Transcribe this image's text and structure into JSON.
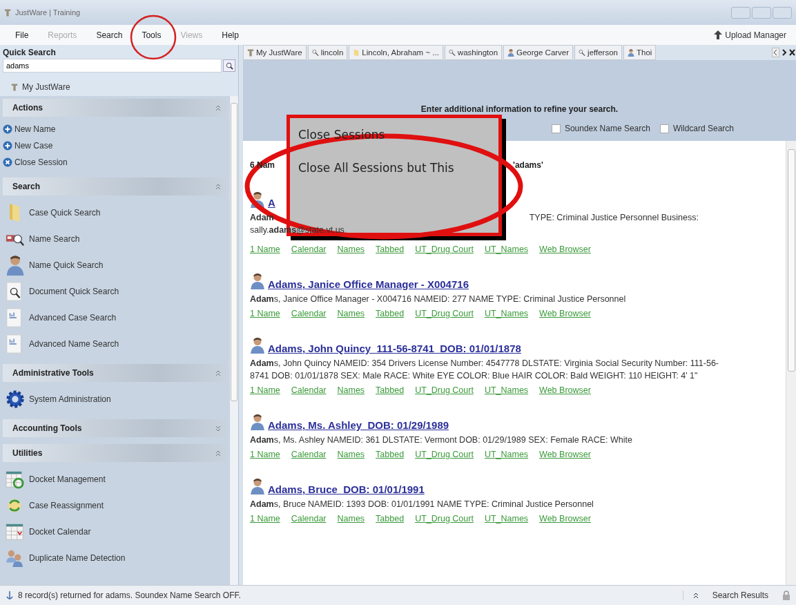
{
  "window": {
    "title": "JustWare | Training"
  },
  "menu": [
    {
      "label": "File",
      "disabled": false
    },
    {
      "label": "Reports",
      "disabled": true
    },
    {
      "label": "Search",
      "disabled": false
    },
    {
      "label": "Tools",
      "disabled": false
    },
    {
      "label": "Views",
      "disabled": true
    },
    {
      "label": "Help",
      "disabled": false
    }
  ],
  "upload_manager": "Upload Manager",
  "quick_search": {
    "label": "Quick Search",
    "value": "adams"
  },
  "home_link": "My JustWare",
  "sections": [
    {
      "title": "Actions",
      "expanded": true,
      "items": [
        {
          "label": "New Name",
          "kind": "add"
        },
        {
          "label": "New Case",
          "kind": "add"
        },
        {
          "label": "Close Session",
          "kind": "close"
        }
      ]
    },
    {
      "title": "Search",
      "expanded": true,
      "items": [
        {
          "label": "Case Quick Search",
          "kind": "folder"
        },
        {
          "label": "Name Search",
          "kind": "card"
        },
        {
          "label": "Name Quick Search",
          "kind": "person"
        },
        {
          "label": "Document Quick Search",
          "kind": "document"
        },
        {
          "label": "Advanced Case Search",
          "kind": "report"
        },
        {
          "label": "Advanced Name Search",
          "kind": "report"
        }
      ]
    },
    {
      "title": "Administrative Tools",
      "expanded": true,
      "items": [
        {
          "label": "System Administration",
          "kind": "gear"
        }
      ]
    },
    {
      "title": "Accounting Tools",
      "expanded": false
    },
    {
      "title": "Utilities",
      "expanded": true,
      "items": [
        {
          "label": "Docket Management",
          "kind": "docket"
        },
        {
          "label": "Case Reassignment",
          "kind": "reassign"
        },
        {
          "label": "Docket Calendar",
          "kind": "calendar"
        },
        {
          "label": "Duplicate Name Detection",
          "kind": "people"
        }
      ]
    }
  ],
  "tabs": [
    {
      "label": "My JustWare",
      "kind": "home"
    },
    {
      "label": "lincoln",
      "kind": "search"
    },
    {
      "label": "Lincoln, Abraham ~ ...",
      "kind": "folder"
    },
    {
      "label": "washington",
      "kind": "search"
    },
    {
      "label": "George Carver",
      "kind": "person"
    },
    {
      "label": "jefferson",
      "kind": "search"
    },
    {
      "label": "Thoi",
      "kind": "person"
    }
  ],
  "refine": {
    "prompt": "Enter additional information to refine your search.",
    "options": [
      {
        "label": "Soundex Name Search",
        "checked": false
      },
      {
        "label": "Wildcard Search",
        "checked": false
      }
    ]
  },
  "results_heading": [
    "6 Nam",
    "'adams'"
  ],
  "results": [
    {
      "title": "A",
      "description": [
        "**Adam**",
        "TYPE: Criminal Justice Personnel Business:"
      ],
      "description_more": "sally.**adams**@state.vt.us",
      "links": [
        "1 Name",
        "Calendar",
        "Names",
        "Tabbed",
        "UT_Drug Court",
        "UT_Names",
        "Web Browser"
      ]
    },
    {
      "title": "Adams, Janice Office Manager - X004716",
      "description": [
        "**Adam**s, Janice Office Manager - X004716 NAMEID: 277 NAME TYPE: Criminal Justice Personnel"
      ],
      "links": [
        "1 Name",
        "Calendar",
        "Names",
        "Tabbed",
        "UT_Drug Court",
        "UT_Names",
        "Web Browser"
      ]
    },
    {
      "title": "Adams, John Quincy  111-56-8741  DOB: 01/01/1878",
      "description": [
        "**Adam**s, John Quincy NAMEID: 354 Drivers License Number: 4547778 DLSTATE: Virginia Social Security Number: 111-56-8741 DOB: 01/01/1878 SEX: Male RACE: White EYE COLOR: Blue HAIR COLOR: Bald WEIGHT: 110 HEIGHT: 4' 1\""
      ],
      "links": [
        "1 Name",
        "Calendar",
        "Names",
        "Tabbed",
        "UT_Drug Court",
        "UT_Names",
        "Web Browser"
      ]
    },
    {
      "title": "Adams, Ms. Ashley  DOB: 01/29/1989",
      "description": [
        "**Adam**s, Ms. Ashley NAMEID: 361 DLSTATE: Vermont DOB: 01/29/1989 SEX: Female RACE: White"
      ],
      "links": [
        "1 Name",
        "Calendar",
        "Names",
        "Tabbed",
        "UT_Drug Court",
        "UT_Names",
        "Web Browser"
      ]
    },
    {
      "title": "Adams, Bruce  DOB: 01/01/1991",
      "description": [
        "**Adam**s, Bruce NAMEID: 1393 DOB: 01/01/1991 NAME TYPE: Criminal Justice Personnel"
      ],
      "links": [
        "1 Name",
        "Calendar",
        "Names",
        "Tabbed",
        "UT_Drug Court",
        "UT_Names",
        "Web Browser"
      ]
    }
  ],
  "context_menu": [
    "Close Sessions",
    "Close All Sessions but This"
  ],
  "status_bar": {
    "message": "8 record(s) returned for adams. Soundex Name Search OFF.",
    "panel": "Search Results"
  }
}
